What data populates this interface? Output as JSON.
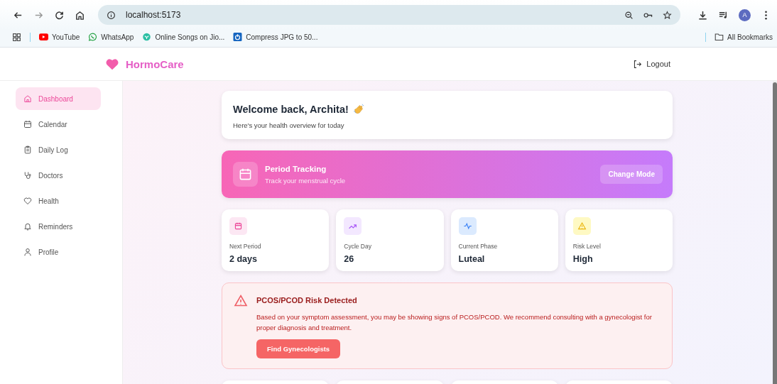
{
  "browser": {
    "url": "localhost:5173",
    "profile_initial": "A",
    "bookmarks": [
      {
        "kind": "youtube",
        "label": "YouTube"
      },
      {
        "kind": "whatsapp",
        "label": "WhatsApp"
      },
      {
        "kind": "jio",
        "label": "Online Songs on Jio..."
      },
      {
        "kind": "compress",
        "label": "Compress JPG to 50..."
      }
    ],
    "all_bookmarks": "All Bookmarks"
  },
  "header": {
    "brand": "HormoCare",
    "logout": "Logout"
  },
  "sidebar": {
    "items": [
      {
        "kind": "home",
        "label": "Dashboard",
        "selected": true
      },
      {
        "kind": "calendar",
        "label": "Calendar",
        "selected": false
      },
      {
        "kind": "clipboard",
        "label": "Daily Log",
        "selected": false
      },
      {
        "kind": "stethoscope",
        "label": "Doctors",
        "selected": false
      },
      {
        "kind": "heart",
        "label": "Health",
        "selected": false
      },
      {
        "kind": "bell",
        "label": "Reminders",
        "selected": false
      },
      {
        "kind": "user",
        "label": "Profile",
        "selected": false
      }
    ]
  },
  "welcome": {
    "title": "Welcome back, Archita!",
    "subtitle": "Here's your health overview for today"
  },
  "mode_banner": {
    "title": "Period Tracking",
    "subtitle": "Track your menstrual cycle",
    "button": "Change Mode"
  },
  "stats": [
    {
      "kind": "calendar",
      "label": "Next Period",
      "value": "2 days"
    },
    {
      "kind": "trend",
      "label": "Cycle Day",
      "value": "26"
    },
    {
      "kind": "pulse",
      "label": "Current Phase",
      "value": "Luteal"
    },
    {
      "kind": "warning",
      "label": "Risk Level",
      "value": "High"
    }
  ],
  "alert": {
    "title": "PCOS/PCOD Risk Detected",
    "message": "Based on your symptom assessment, you may be showing signs of PCOS/PCOD. We recommend consulting with a gynecologist for proper diagnosis and treatment.",
    "button": "Find Gynecologists"
  }
}
